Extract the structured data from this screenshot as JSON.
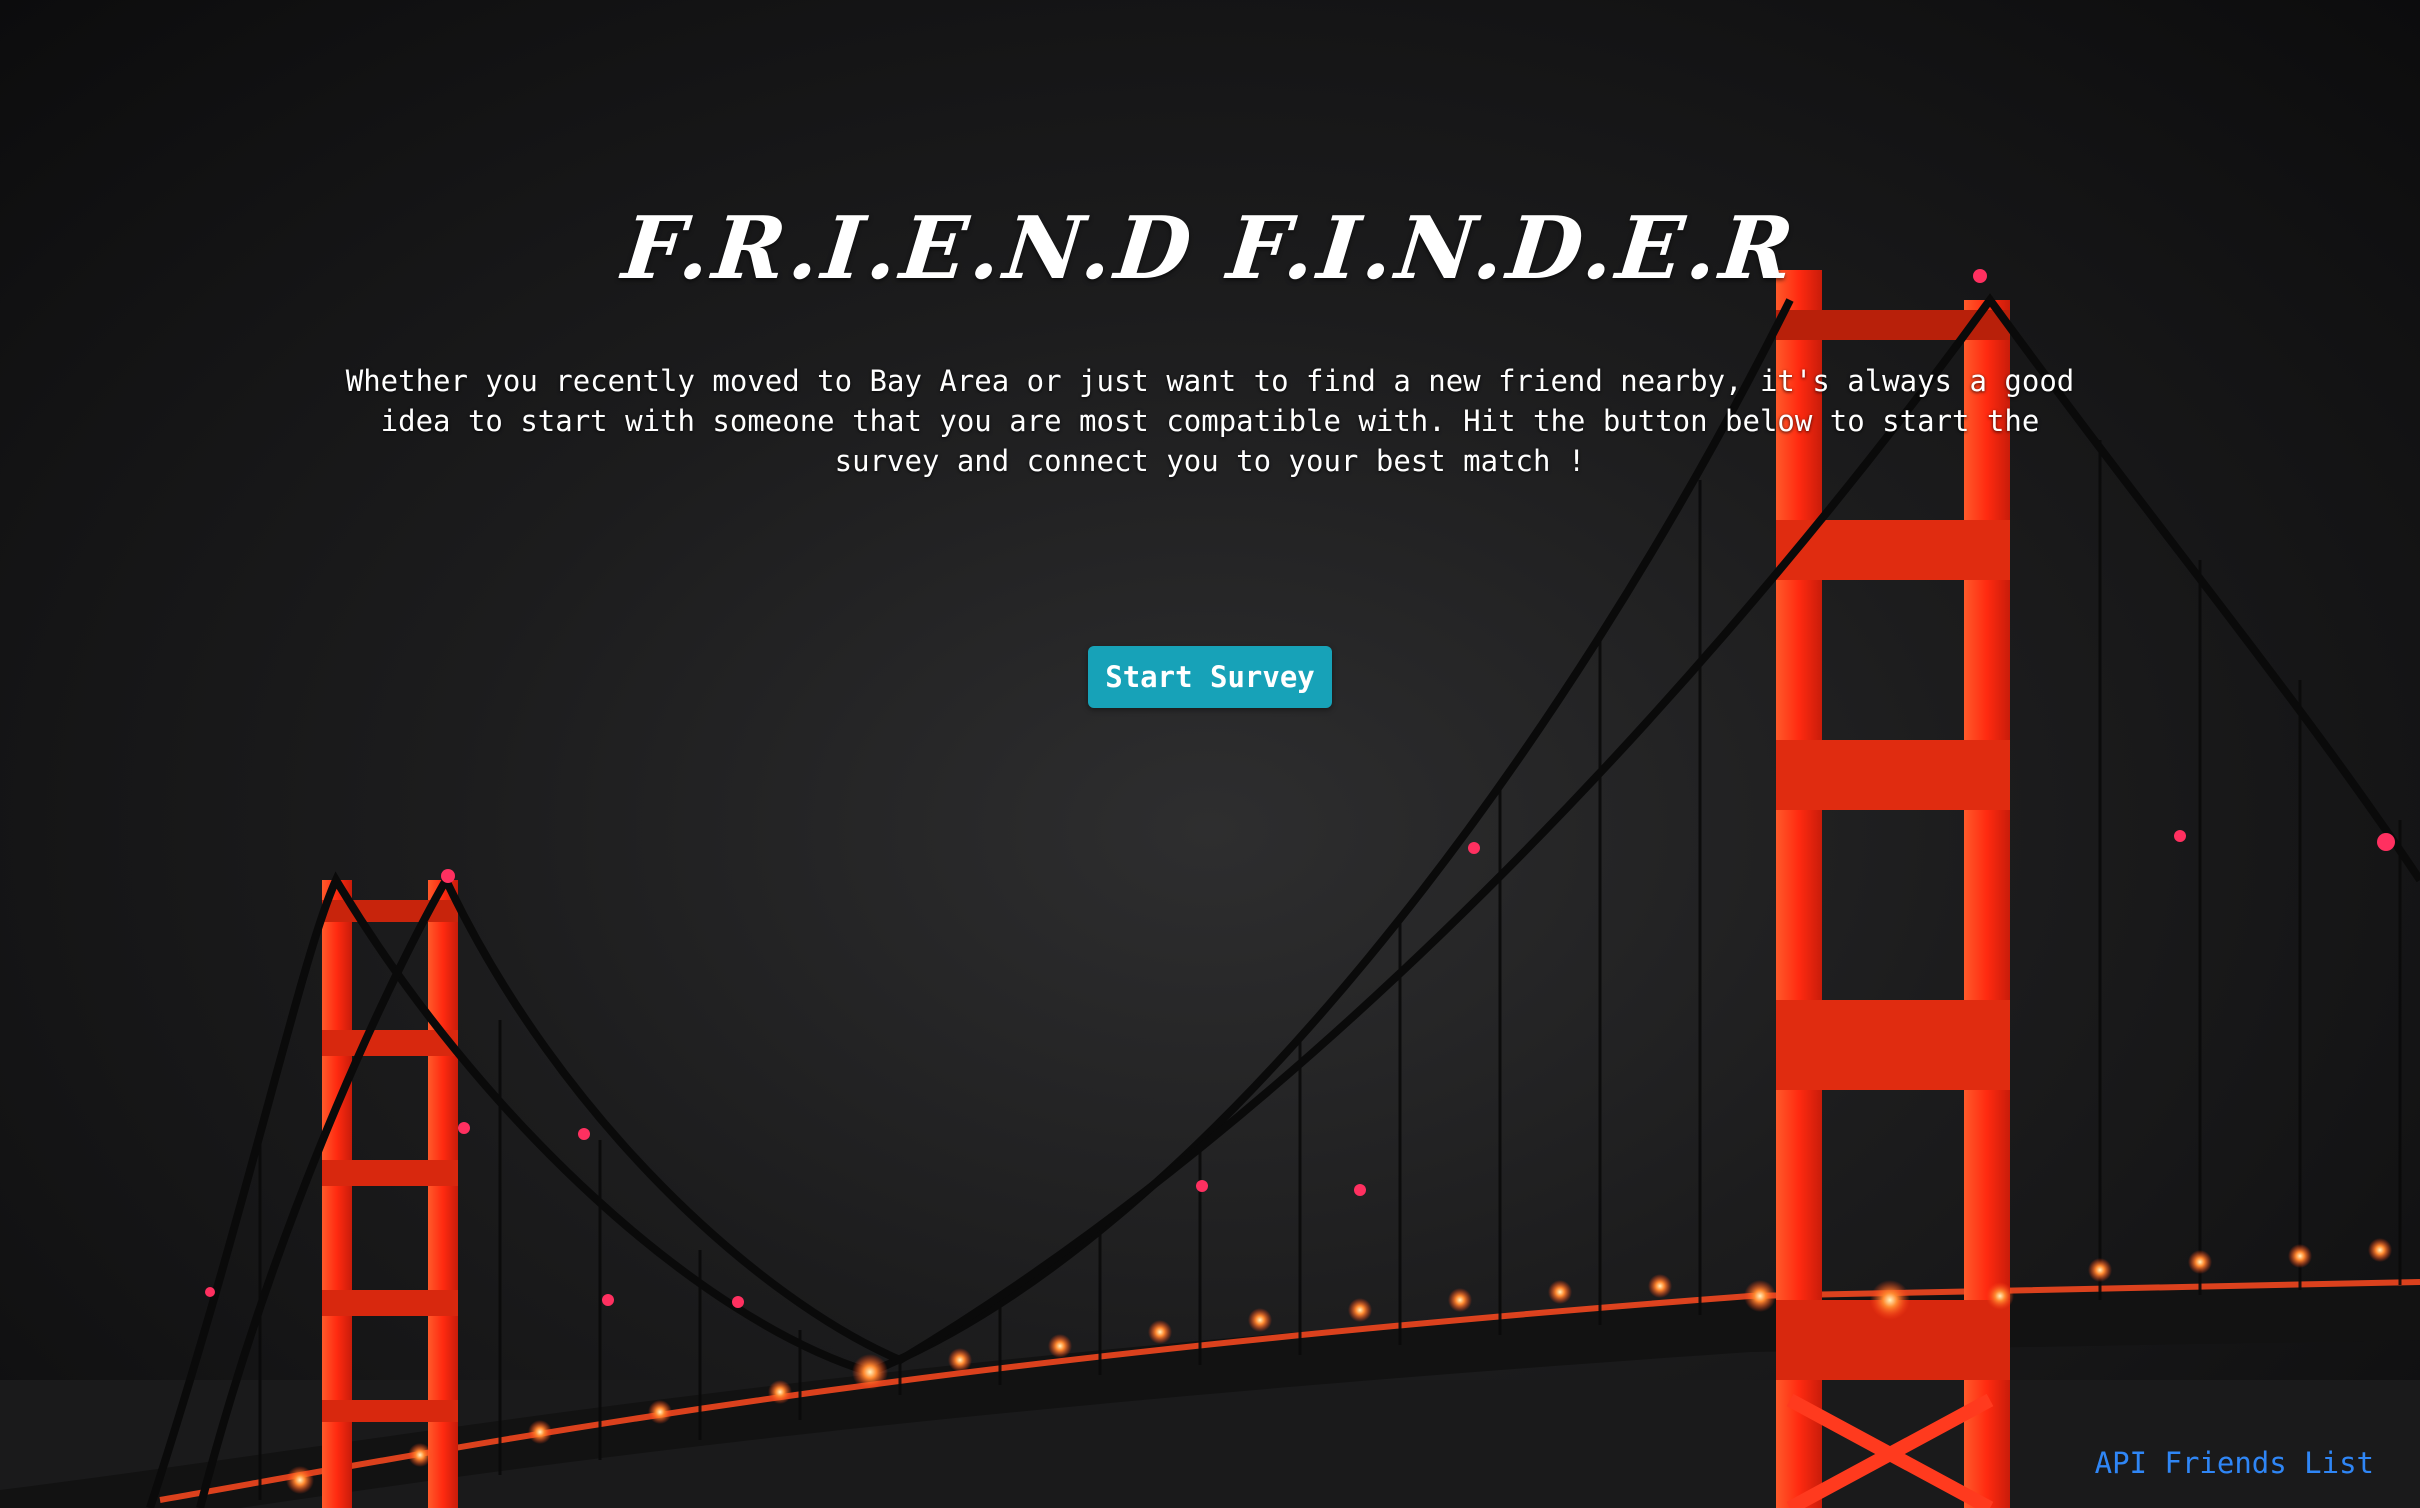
{
  "header": {
    "title": "F.R.I.E.N.D F.I.N.D.E.R"
  },
  "main": {
    "intro": "Whether you recently moved to Bay Area or just want to find a new friend nearby, it's always a good idea to start with someone that you are most compatible with. Hit the button below to start the survey and connect you to your best match !",
    "start_button_label": "Start Survey"
  },
  "footer": {
    "api_link_label": "API Friends List"
  },
  "colors": {
    "accent_button": "#17a2b8",
    "link": "#2f86f6",
    "bridge_red": "#ff3a1e"
  }
}
